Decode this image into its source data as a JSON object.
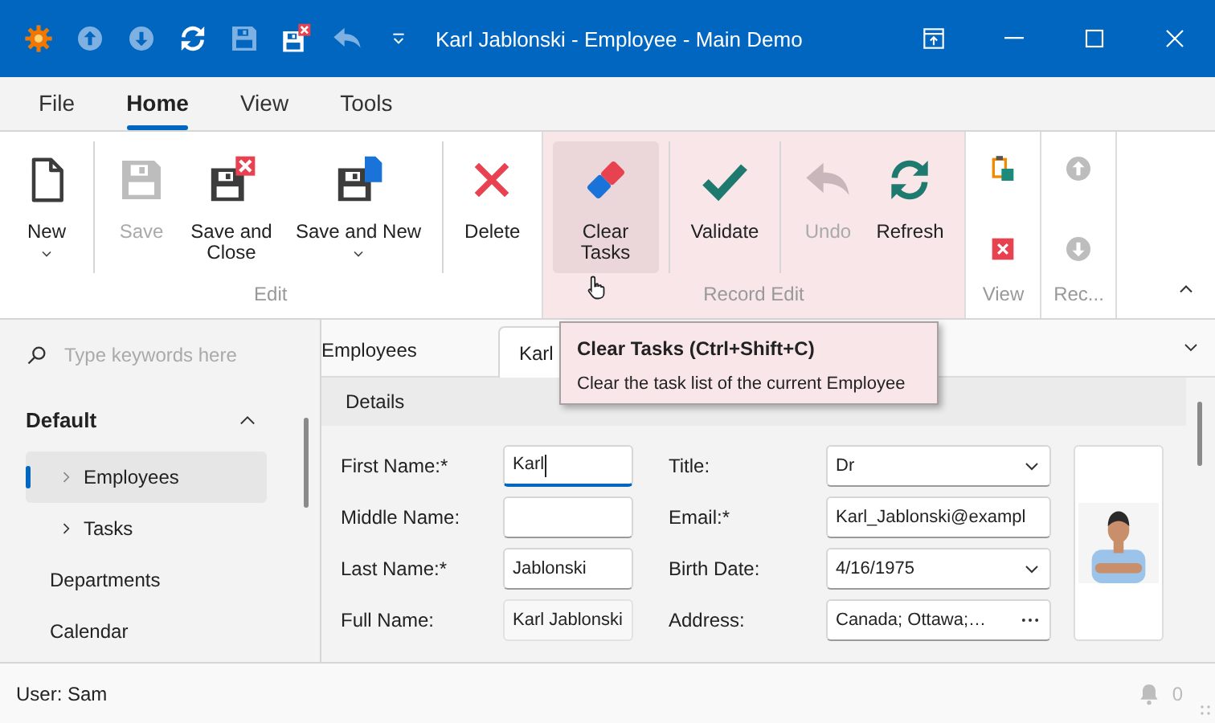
{
  "window": {
    "title": "Karl Jablonski - Employee - Main Demo"
  },
  "quick_access": [
    {
      "kind": "gear",
      "disabled": false
    },
    {
      "kind": "circle-up",
      "disabled": true
    },
    {
      "kind": "circle-down",
      "disabled": true
    },
    {
      "kind": "refresh",
      "disabled": false
    },
    {
      "kind": "floppy",
      "disabled": true
    },
    {
      "kind": "save-close",
      "disabled": false
    },
    {
      "kind": "undo",
      "disabled": true
    },
    {
      "kind": "customize",
      "disabled": false
    }
  ],
  "ribbon_tabs": [
    {
      "label": "File",
      "selected": false
    },
    {
      "label": "Home",
      "selected": true
    },
    {
      "label": "View",
      "selected": false
    },
    {
      "label": "Tools",
      "selected": false
    }
  ],
  "ribbon_groups": [
    {
      "label": "Edit",
      "highlighted": false,
      "buttons": [
        {
          "kind": "new-doc",
          "label": "New",
          "dropdown": true,
          "disabled": false,
          "hovered": false
        },
        {
          "kind": "floppy",
          "label": "Save",
          "dropdown": false,
          "disabled": true,
          "hovered": false,
          "divider_before": true
        },
        {
          "kind": "save-close",
          "label": "Save and Close",
          "dropdown": false,
          "disabled": false,
          "hovered": false
        },
        {
          "kind": "save-new",
          "label": "Save and New",
          "dropdown": true,
          "disabled": false,
          "hovered": false
        },
        {
          "kind": "delete",
          "label": "Delete",
          "dropdown": false,
          "disabled": false,
          "hovered": false,
          "divider_before": true
        }
      ]
    },
    {
      "label": "Record Edit",
      "highlighted": true,
      "buttons": [
        {
          "kind": "eraser",
          "label": "Clear Tasks",
          "dropdown": false,
          "disabled": false,
          "hovered": true
        },
        {
          "kind": "check",
          "label": "Validate",
          "dropdown": false,
          "disabled": false,
          "hovered": false,
          "divider_before": true
        },
        {
          "kind": "undo",
          "label": "Undo",
          "dropdown": false,
          "disabled": true,
          "hovered": false,
          "divider_before": true
        },
        {
          "kind": "refresh",
          "label": "Refresh",
          "dropdown": false,
          "disabled": false,
          "hovered": false
        }
      ]
    },
    {
      "label": "View",
      "highlighted": false,
      "buttons": [
        {
          "kind": "clipboard",
          "disabled": false
        },
        {
          "kind": "xbox",
          "disabled": false
        }
      ]
    },
    {
      "label": "Rec...",
      "highlighted": false,
      "buttons": [
        {
          "kind": "circle-up",
          "disabled": true
        },
        {
          "kind": "circle-down",
          "disabled": true
        }
      ]
    }
  ],
  "tooltip": {
    "title": "Clear Tasks (Ctrl+Shift+C)",
    "description": "Clear the task list of the current Employee"
  },
  "search": {
    "placeholder": "Type keywords here"
  },
  "navigation": {
    "group": {
      "label": "Default",
      "expanded": true
    },
    "items": [
      {
        "label": "Employees",
        "selected": true,
        "expandable": true
      },
      {
        "label": "Tasks",
        "selected": false,
        "expandable": true
      },
      {
        "label": "Departments",
        "selected": false,
        "expandable": false
      },
      {
        "label": "Calendar",
        "selected": false,
        "expandable": false
      }
    ]
  },
  "document_tabs": [
    {
      "label": "Employees",
      "selected": false
    },
    {
      "label": "Karl",
      "selected": true
    }
  ],
  "details": {
    "title": "Details",
    "left_fields": [
      {
        "label": "First Name:*",
        "value": "Karl",
        "kind": "text",
        "focused": true
      },
      {
        "label": "Middle Name:",
        "kind": "text",
        "focused": false
      },
      {
        "label": "Last Name:*",
        "value": "Jablonski",
        "kind": "text",
        "focused": false
      },
      {
        "label": "Full Name:",
        "value": "Karl Jablonski",
        "kind": "readonly",
        "focused": false
      }
    ],
    "right_fields": [
      {
        "label": "Title:",
        "value": "Dr",
        "kind": "dropdown",
        "focused": false
      },
      {
        "label": "Email:*",
        "value": "Karl_Jablonski@exampl",
        "kind": "text",
        "focused": false
      },
      {
        "label": "Birth Date:",
        "value": "4/16/1975",
        "kind": "dropdown",
        "focused": false
      },
      {
        "label": "Address:",
        "value": "Canada; Ottawa;…",
        "kind": "ellipsis",
        "focused": false
      }
    ]
  },
  "status_bar": {
    "user": "User: Sam",
    "notifications": "0"
  }
}
